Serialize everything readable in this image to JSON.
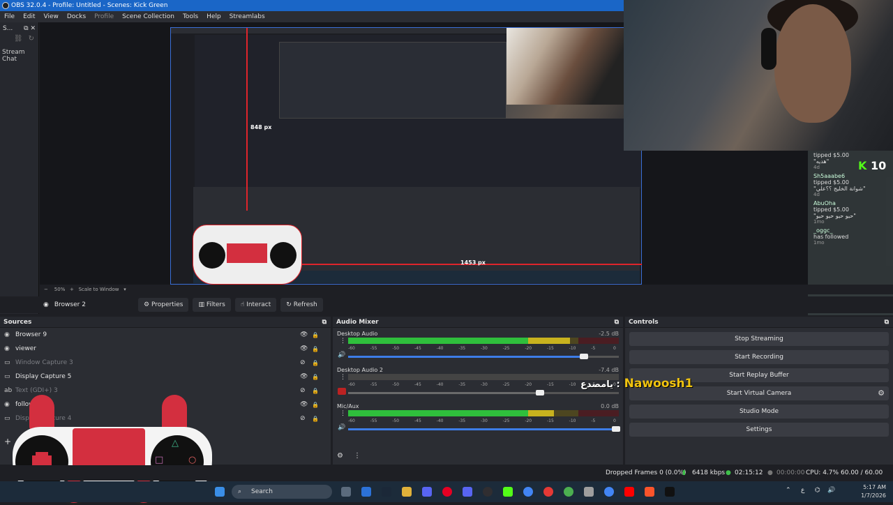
{
  "titlebar": {
    "title": "OBS 32.0.4 - Profile: Untitled - Scenes: Kick Green"
  },
  "menu": {
    "items": [
      "File",
      "Edit",
      "View",
      "Docks",
      "Profile",
      "Scene Collection",
      "Tools",
      "Help",
      "Streamlabs"
    ]
  },
  "chat_dock": {
    "short_title": "S...",
    "title": "Stream Chat"
  },
  "preview": {
    "label_848": "848 px",
    "label_1453": "1453 px",
    "zoom": "50%",
    "scale_mode": "Scale to Window"
  },
  "chat_overlay": {
    "kick_count": "10",
    "messages": [
      {
        "name": "",
        "text": "tipped $5.00",
        "sub": "\"هديه\"",
        "time": "4d"
      },
      {
        "name": "Sh5aaabe6",
        "text": "tipped $5.00",
        "sub": "\"شوانة الخليج ؟؟علي\"",
        "time": "4d"
      },
      {
        "name": "AbuOha",
        "text": "tipped $5.00",
        "sub": "\"حيو حيو حيو حيو\"",
        "time": "1mo"
      },
      {
        "name": "_oggc_",
        "text": "has followed",
        "sub": "",
        "time": "1mo"
      }
    ]
  },
  "source_toolbar": {
    "selected_source": "Browser 2",
    "properties": "Properties",
    "filters": "Filters",
    "interact": "Interact",
    "refresh": "Refresh"
  },
  "sources": {
    "title": "Sources",
    "items": [
      {
        "name": "Browser 9",
        "dim": false
      },
      {
        "name": "viewer",
        "dim": false
      },
      {
        "name": "Window Capture 3",
        "dim": true
      },
      {
        "name": "Display Capture 5",
        "dim": false
      },
      {
        "name": "Text (GDI+) 3",
        "dim": true
      },
      {
        "name": "follow",
        "dim": false
      },
      {
        "name": "Display Capture 4",
        "dim": true
      }
    ]
  },
  "mixer": {
    "title": "Audio Mixer",
    "scale": [
      "-60",
      "-55",
      "-50",
      "-45",
      "-40",
      "-35",
      "-30",
      "-25",
      "-20",
      "-15",
      "-10",
      "-5",
      "0"
    ],
    "channels": [
      {
        "name": "Desktop Audio",
        "db": "-2.5 dB",
        "volume": 0.87,
        "level": 0.82
      },
      {
        "name": "Desktop Audio 2",
        "db": "-7.4 dB",
        "volume": 0.71,
        "level": 0.0
      },
      {
        "name": "Mic/Aux",
        "db": "0.0 dB",
        "volume": 0.99,
        "level": 0.76
      }
    ]
  },
  "controls": {
    "title": "Controls",
    "buttons": [
      "Stop Streaming",
      "Start Recording",
      "Start Replay Buffer",
      "Start Virtual Camera",
      "Studio Mode",
      "Settings"
    ]
  },
  "overlay_text": {
    "name": "Nawoosh1",
    "arabic": "يامصدع :"
  },
  "status": {
    "dropped": "Dropped Frames 0 (0.0%)",
    "kbps": "6418 kbps",
    "stream_time": "02:15:12",
    "rec_time": "00:00:00",
    "cpu": "CPU: 4.7%",
    "fps": "60.00 / 60.00 FPS"
  },
  "taskbar": {
    "search": "Search",
    "time": "5:17 AM",
    "date": "1/7/2026",
    "lang": "ع"
  },
  "colors": {
    "accent": "#1a66c7",
    "meter_green": "#2fbf3c",
    "meter_yellow": "#c8b21e",
    "meter_red": "#b21e2b",
    "kick_green": "#53fc18"
  }
}
